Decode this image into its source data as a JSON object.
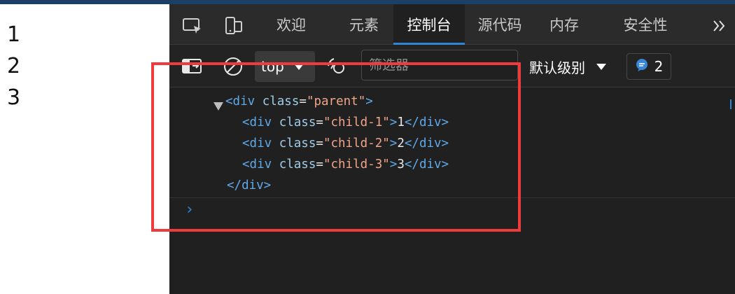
{
  "page": {
    "lines": [
      "1",
      "2",
      "3"
    ]
  },
  "devtools": {
    "tabs": [
      {
        "label": "欢迎"
      },
      {
        "label": "元素"
      },
      {
        "label": "控制台"
      },
      {
        "label": "源代码"
      },
      {
        "label": "内存"
      },
      {
        "label": "安全性"
      }
    ],
    "active_tab": "控制台",
    "overflow_icon": "double-chevron-right",
    "toolbar": {
      "context": "top",
      "filter_placeholder": "筛选器",
      "log_level": "默认级别",
      "issues_count": "2"
    },
    "console": {
      "open_tag": {
        "name": "div",
        "attr": "class",
        "value": "\"parent\""
      },
      "children": [
        {
          "name": "div",
          "attr": "class",
          "value": "\"child-1\"",
          "text": "1"
        },
        {
          "name": "div",
          "attr": "class",
          "value": "\"child-2\"",
          "text": "2"
        },
        {
          "name": "div",
          "attr": "class",
          "value": "\"child-3\"",
          "text": "3"
        }
      ],
      "close_tag": "</div>",
      "prompt_symbol": "›"
    }
  },
  "colors": {
    "highlight": "#ef3b3b",
    "accent": "#2f86d6",
    "tag": "#5fa8e8",
    "attr_value": "#f0a58a"
  }
}
